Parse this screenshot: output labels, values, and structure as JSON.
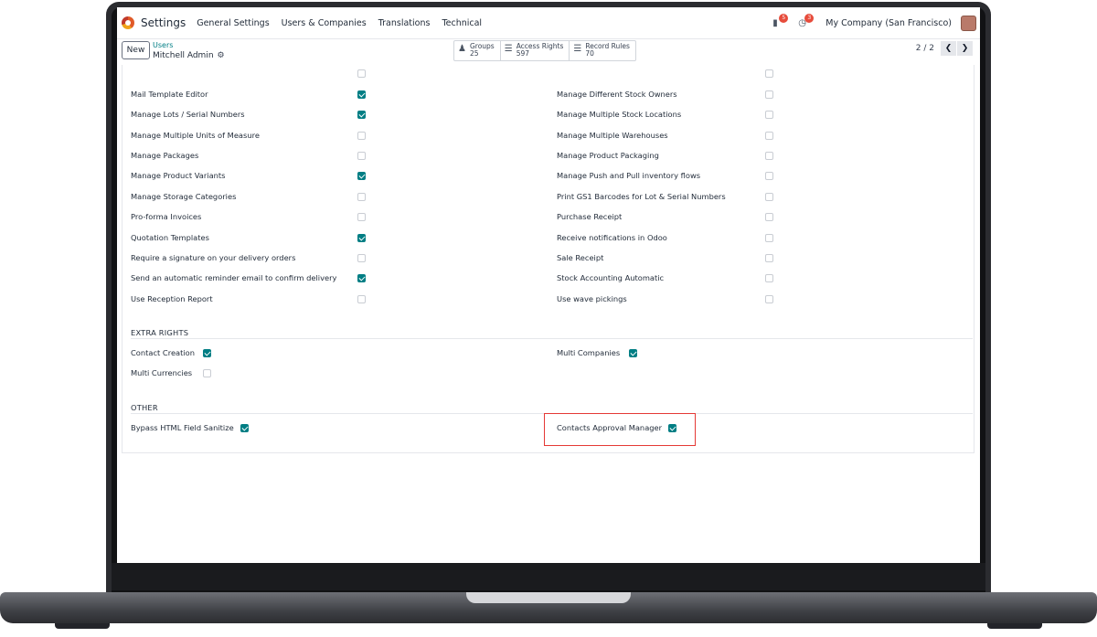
{
  "app": {
    "name": "Settings"
  },
  "nav": {
    "menu": [
      "General Settings",
      "Users & Companies",
      "Translations",
      "Technical"
    ],
    "messages_count": "5",
    "activities_count": "3",
    "company": "My Company (San Francisco)"
  },
  "control": {
    "new_label": "New",
    "breadcrumb": "Users",
    "record": "Mitchell Admin",
    "smart_buttons": [
      {
        "label": "Groups",
        "count": "25",
        "icon": "users-icon"
      },
      {
        "label": "Access Rights",
        "count": "597",
        "icon": "list-icon"
      },
      {
        "label": "Record Rules",
        "count": "70",
        "icon": "list-icon"
      }
    ],
    "pager": "2 / 2"
  },
  "technical": {
    "left": [
      {
        "label": "Mail Template Editor",
        "checked": true
      },
      {
        "label": "Manage Lots / Serial Numbers",
        "checked": true
      },
      {
        "label": "Manage Multiple Units of Measure",
        "checked": false
      },
      {
        "label": "Manage Packages",
        "checked": false
      },
      {
        "label": "Manage Product Variants",
        "checked": true
      },
      {
        "label": "Manage Storage Categories",
        "checked": false
      },
      {
        "label": "Pro-forma Invoices",
        "checked": false
      },
      {
        "label": "Quotation Templates",
        "checked": true
      },
      {
        "label": "Require a signature on your delivery orders",
        "checked": false
      },
      {
        "label": "Send an automatic reminder email to confirm delivery",
        "checked": true
      },
      {
        "label": "Use Reception Report",
        "checked": false
      }
    ],
    "right": [
      {
        "label": "Manage Different Stock Owners",
        "checked": false
      },
      {
        "label": "Manage Multiple Stock Locations",
        "checked": false
      },
      {
        "label": "Manage Multiple Warehouses",
        "checked": false
      },
      {
        "label": "Manage Product Packaging",
        "checked": false
      },
      {
        "label": "Manage Push and Pull inventory flows",
        "checked": false
      },
      {
        "label": "Print GS1 Barcodes for Lot & Serial Numbers",
        "checked": false
      },
      {
        "label": "Purchase Receipt",
        "checked": false
      },
      {
        "label": "Receive notifications in Odoo",
        "checked": false
      },
      {
        "label": "Sale Receipt",
        "checked": false
      },
      {
        "label": "Stock Accounting Automatic",
        "checked": false
      },
      {
        "label": "Use wave pickings",
        "checked": false
      }
    ]
  },
  "extra_rights": {
    "title": "EXTRA RIGHTS",
    "items": [
      {
        "label": "Contact Creation",
        "checked": true
      },
      {
        "label": "Multi Companies",
        "checked": true
      },
      {
        "label": "Multi Currencies",
        "checked": false
      }
    ]
  },
  "other": {
    "title": "OTHER",
    "items": [
      {
        "label": "Bypass HTML Field Sanitize",
        "checked": true
      },
      {
        "label": "Contacts Approval Manager",
        "checked": true
      }
    ]
  },
  "colors": {
    "accent": "#017e84",
    "highlight": "#e53935",
    "link": "#017e84"
  }
}
